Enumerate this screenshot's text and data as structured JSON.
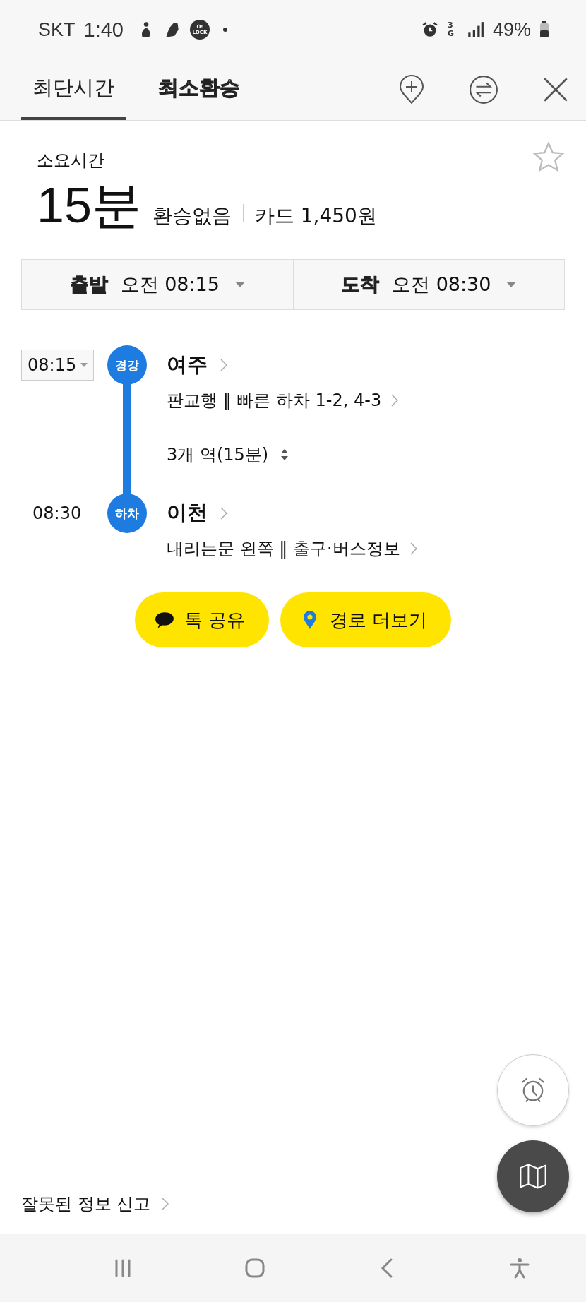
{
  "status_bar": {
    "carrier": "SKT",
    "time": "1:40",
    "app_badge": "O! LOCK",
    "network": "3G",
    "battery": "49%"
  },
  "tabs": [
    {
      "label": "최단시간",
      "selected": true
    },
    {
      "label": "최소환승",
      "selected": false
    }
  ],
  "summary": {
    "label": "소요시간",
    "duration": "15분",
    "transfers": "환승없음",
    "fare": "카드 1,450원",
    "favorite": false
  },
  "time_selectors": [
    {
      "label": "출발",
      "value": "오전 08:15"
    },
    {
      "label": "도착",
      "value": "오전 08:30"
    }
  ],
  "route": {
    "stops": [
      {
        "time": "08:15",
        "dropdown": true,
        "badge": "경강",
        "color": "#1e7be0",
        "name": "여주",
        "detail": "판교행 ‖ 빠른 하차 1-2, 4-3"
      },
      {
        "time": "08:30",
        "dropdown": false,
        "badge": "하차",
        "color": "#1e7be0",
        "name": "이천",
        "detail": "내리는문 왼쪽 ‖ 출구·버스정보"
      }
    ],
    "stations": "3개 역(15분)"
  },
  "actions": [
    {
      "kind": "talk",
      "label": "톡 공유"
    },
    {
      "kind": "pin",
      "label": "경로 더보기"
    }
  ],
  "report": "잘못된 정보 신고"
}
